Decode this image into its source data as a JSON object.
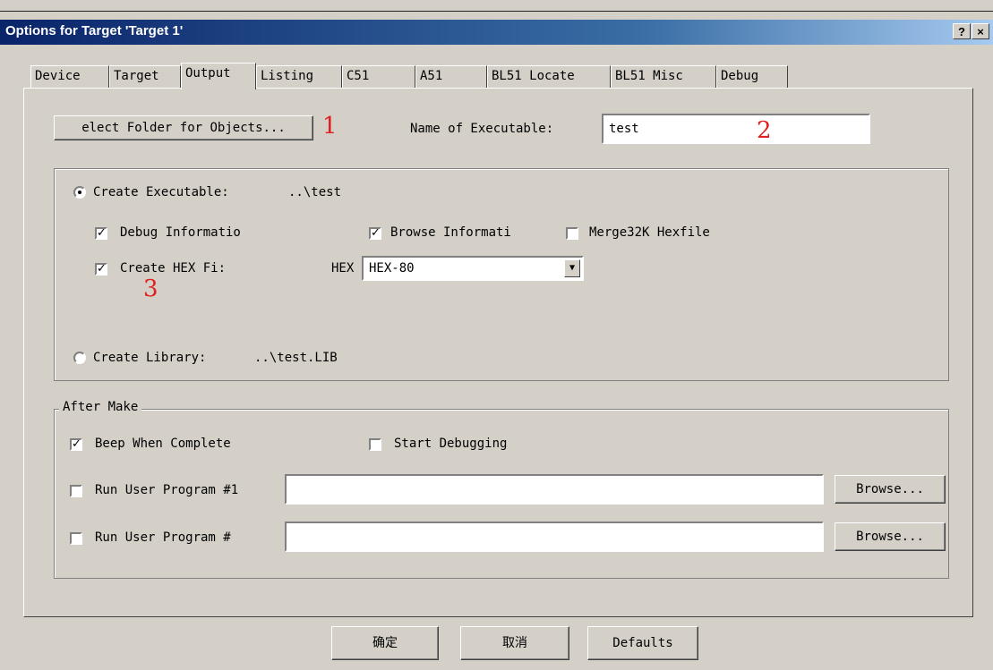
{
  "window": {
    "title": "Options for Target 'Target 1'",
    "help_label": "?",
    "close_label": "×"
  },
  "tabs": [
    {
      "label": "Device"
    },
    {
      "label": "Target"
    },
    {
      "label": "Output"
    },
    {
      "label": "Listing"
    },
    {
      "label": "C51"
    },
    {
      "label": "A51"
    },
    {
      "label": "BL51 Locate"
    },
    {
      "label": "BL51 Misc"
    },
    {
      "label": "Debug"
    }
  ],
  "output": {
    "select_folder_label": "elect Folder for Objects...",
    "name_label": "Name of Executable:",
    "name_value": "test",
    "create_executable_label": "Create Executable:",
    "create_executable_path": "..\\test",
    "debug_info_label": "Debug Informatio",
    "browse_info_label": "Browse Informati",
    "merge_label": "Merge32K Hexfile",
    "create_hex_label": "Create HEX Fi:",
    "hex_label": "HEX",
    "hex_value": "HEX-80",
    "create_library_label": "Create Library:",
    "create_library_path": "..\\test.LIB",
    "checks": {
      "debug": "✓",
      "browse": "✓",
      "merge": "",
      "hex": "✓"
    }
  },
  "after_make": {
    "legend": "After Make",
    "beep_label": "Beep When Complete",
    "start_debug_label": "Start Debugging",
    "run1_label": "Run User Program #1",
    "run2_label": "Run User Program #",
    "browse_label": "Browse...",
    "checks": {
      "beep": "✓",
      "start": "",
      "run1": "",
      "run2": ""
    }
  },
  "annotations": [
    "1",
    "2",
    "3"
  ],
  "footer": {
    "ok_label": "确定",
    "cancel_label": "取消",
    "defaults_label": "Defaults"
  },
  "colors": {
    "title_start": "#0a246a",
    "title_end": "#a6caf0",
    "annotation": "#e02020",
    "face": "#d4d0c8"
  }
}
